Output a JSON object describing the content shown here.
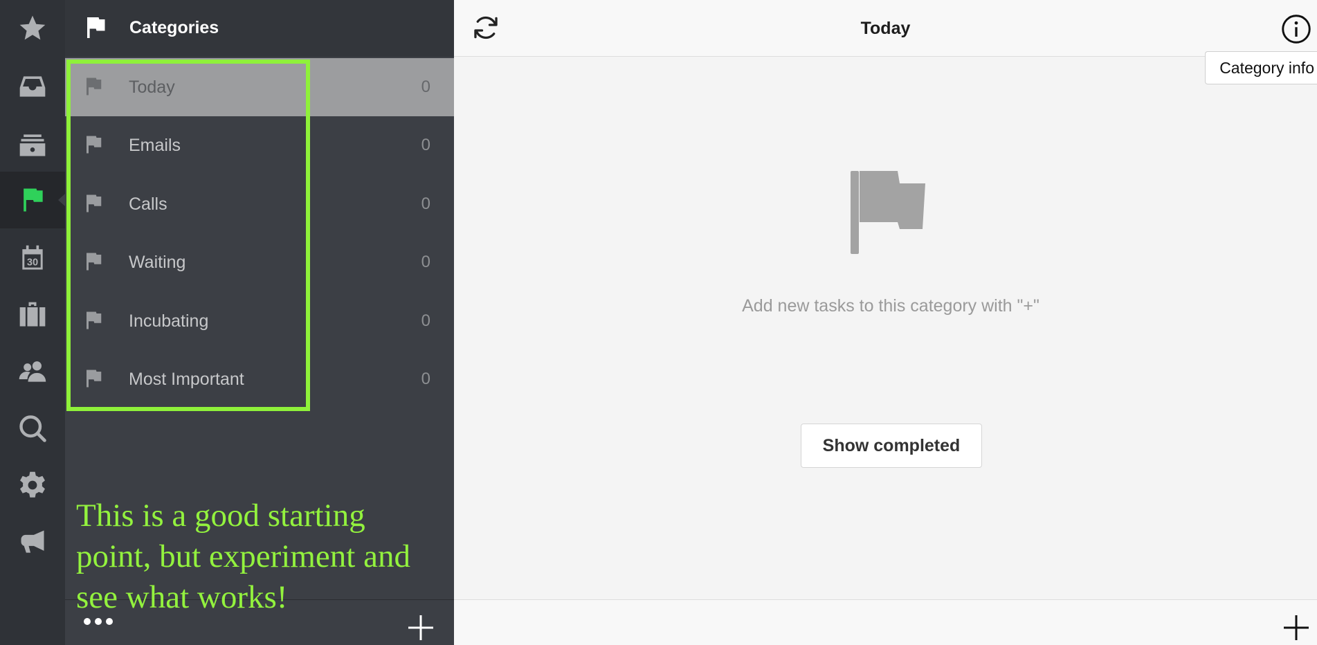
{
  "sidebar": {
    "title": "Categories",
    "items": [
      {
        "name": "Today",
        "count": "0"
      },
      {
        "name": "Emails",
        "count": "0"
      },
      {
        "name": "Calls",
        "count": "0"
      },
      {
        "name": "Waiting",
        "count": "0"
      },
      {
        "name": "Incubating",
        "count": "0"
      },
      {
        "name": "Most Important",
        "count": "0"
      }
    ],
    "selected_index": 0
  },
  "rail": {
    "icons": [
      "star-icon",
      "inbox-icon",
      "archive-icon",
      "flag-icon",
      "calendar-icon",
      "briefcase-icon",
      "people-icon",
      "search-icon",
      "gear-icon",
      "megaphone-icon"
    ],
    "calendar_day": "30",
    "active_index": 3,
    "active_color": "#2fd15a"
  },
  "annotation": {
    "text": "This is a good starting point, but experiment and see what works!",
    "color": "#93f23e"
  },
  "main": {
    "title": "Today",
    "tooltip": "Category info",
    "empty_text": "Add new tasks to this category with \"+\"",
    "show_completed_label": "Show completed"
  }
}
